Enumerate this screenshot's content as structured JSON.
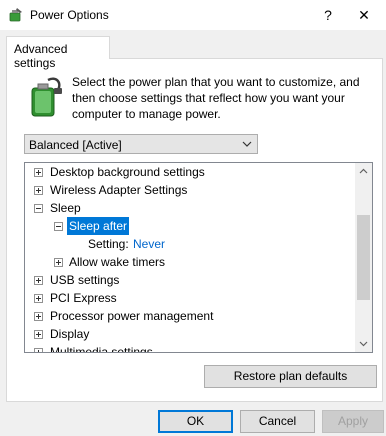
{
  "window": {
    "title": "Power Options",
    "help": "?",
    "close": "✕"
  },
  "tab": {
    "label": "Advanced settings"
  },
  "description": "Select the power plan that you want to customize, and then choose settings that reflect how you want your computer to manage power.",
  "plan_select": {
    "value": "Balanced [Active]"
  },
  "tree": {
    "items": [
      {
        "label": "Desktop background settings",
        "expander": "plus"
      },
      {
        "label": "Wireless Adapter Settings",
        "expander": "plus"
      },
      {
        "label": "Sleep",
        "expander": "minus"
      },
      {
        "label": "Sleep after",
        "expander": "minus",
        "selected": true
      },
      {
        "label": "Setting:",
        "value": "Never"
      },
      {
        "label": "Allow wake timers",
        "expander": "plus"
      },
      {
        "label": "USB settings",
        "expander": "plus"
      },
      {
        "label": "PCI Express",
        "expander": "plus"
      },
      {
        "label": "Processor power management",
        "expander": "plus"
      },
      {
        "label": "Display",
        "expander": "plus"
      },
      {
        "label": "Multimedia settings",
        "expander": "plus"
      }
    ]
  },
  "buttons": {
    "restore": "Restore plan defaults",
    "ok": "OK",
    "cancel": "Cancel",
    "apply": "Apply"
  },
  "icons": {
    "app": "power-options-icon",
    "battery": "battery-plan-icon",
    "dropdown": "chevron-down-icon"
  },
  "colors": {
    "selection": "#0078d7",
    "link": "#0066cc",
    "accent": "#0078d7"
  }
}
